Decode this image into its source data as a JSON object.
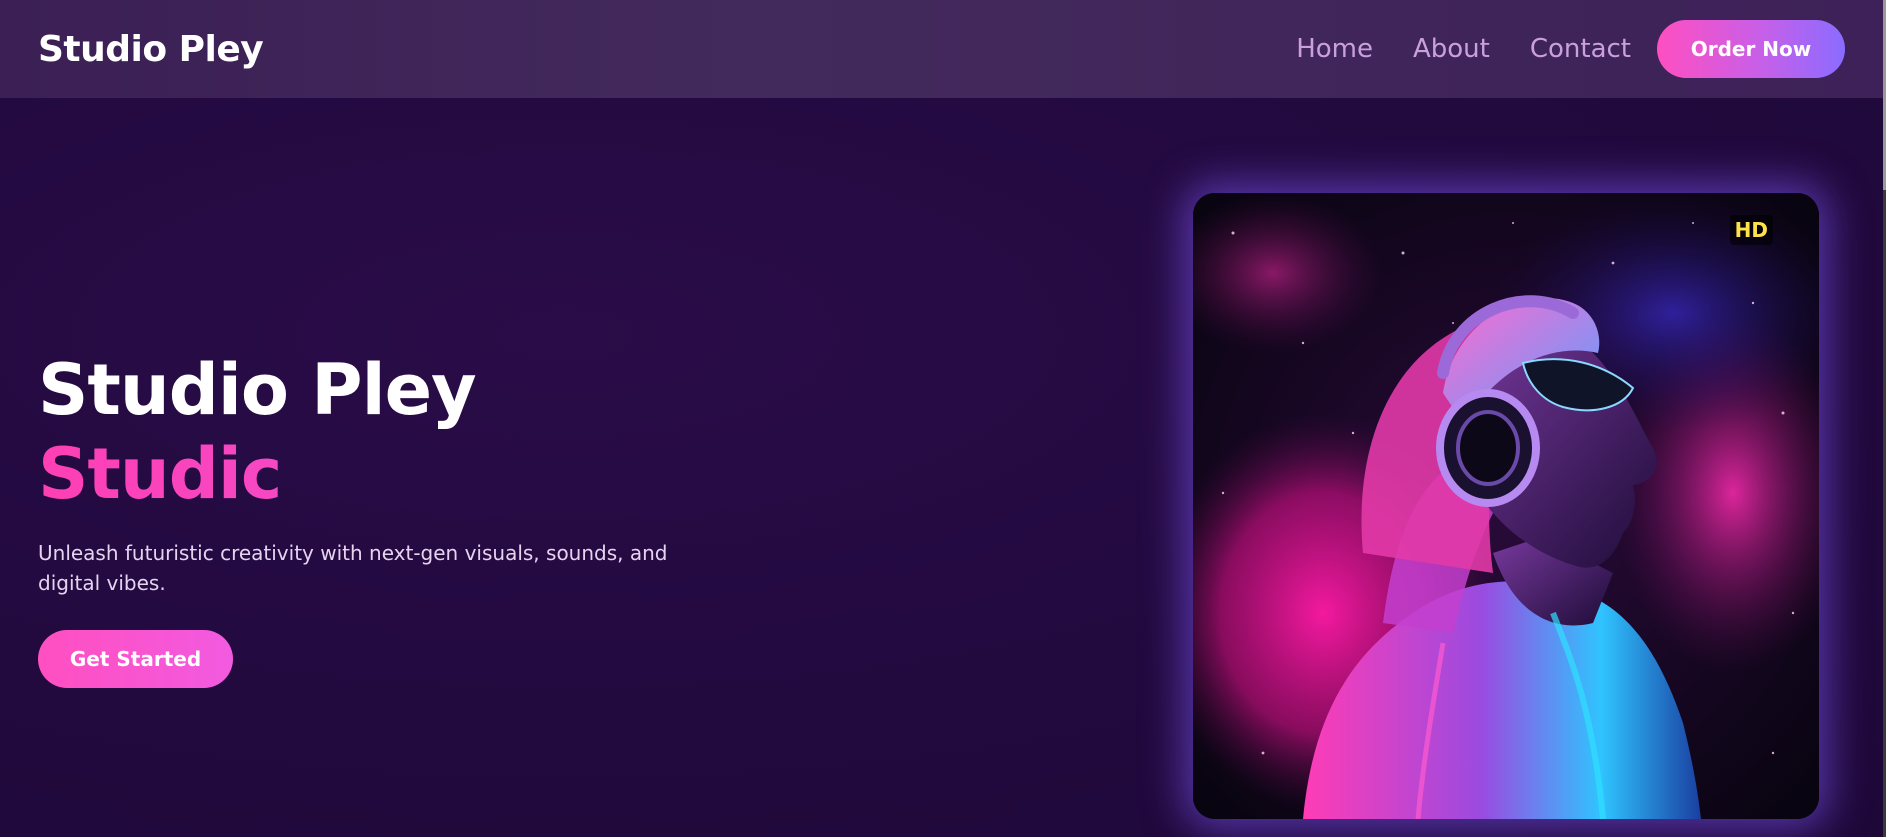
{
  "header": {
    "brand": "Studio Pley",
    "nav": [
      {
        "label": "Home"
      },
      {
        "label": "About"
      },
      {
        "label": "Contact"
      }
    ],
    "order_button": "Order Now"
  },
  "hero": {
    "title": "Studio Pley",
    "subtitle": "Studic",
    "description": "Unleash futuristic creativity with next-gen visuals, sounds, and digital vibes.",
    "cta": "Get Started"
  },
  "image": {
    "badge": "HD",
    "subject": "neon-listener-illustration"
  },
  "colors": {
    "background": "#220a3e",
    "header": "#402658",
    "accent_pink": "#ff4fc0",
    "accent_purple": "#8a6cff",
    "nav_text": "#c9a0dc"
  }
}
